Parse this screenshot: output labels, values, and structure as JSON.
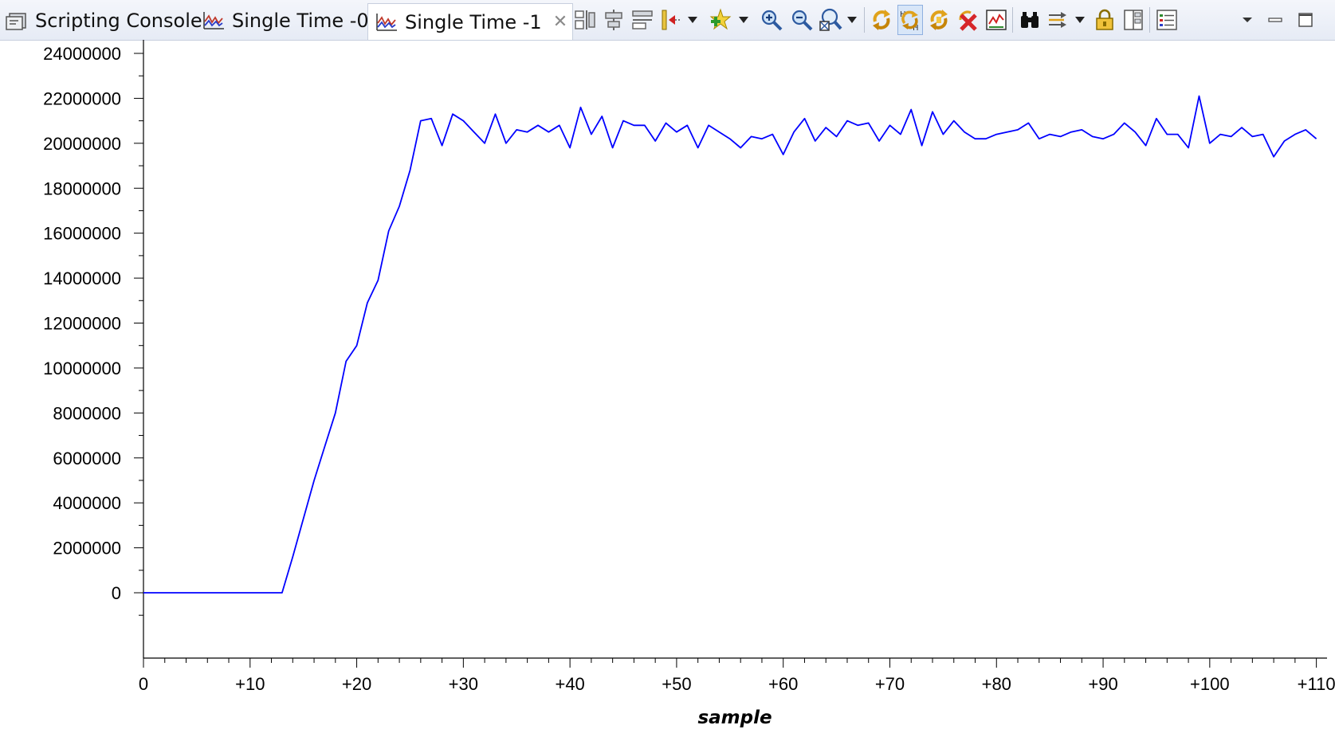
{
  "tabs": [
    {
      "label": "Scripting Console",
      "icon": "scripting-console-icon",
      "active": false
    },
    {
      "label": "Single Time -0",
      "icon": "graph-icon",
      "active": false
    },
    {
      "label": "Single Time -1",
      "icon": "graph-icon",
      "active": true,
      "closable": true
    }
  ],
  "toolbar": [
    "align-columns-icon",
    "align-center-icon",
    "align-rows-icon",
    "set-marker-icon",
    "dropdown-arrow-icon",
    "add-measurement-icon",
    "dropdown-arrow-icon",
    "zoom-in-icon",
    "zoom-out-icon",
    "zoom-fit-icon",
    "dropdown-arrow-icon",
    "refresh-icon",
    "toggle-hex-icon",
    "continuous-refresh-icon",
    "remove-icon",
    "graph-properties-icon",
    "find-icon",
    "import-export-icon",
    "dropdown-arrow-icon",
    "lock-icon",
    "layout-icon",
    "legend-icon"
  ],
  "window_controls": [
    "view-menu-icon",
    "minimize-icon",
    "maximize-icon"
  ],
  "chart_data": {
    "type": "line",
    "title": "",
    "xlabel": "sample",
    "ylabel": "",
    "xlim": [
      0,
      111
    ],
    "ylim": [
      -2000000,
      24000000
    ],
    "grid": false,
    "line_color": "#0000ff",
    "y_ticks": [
      0,
      2000000,
      4000000,
      6000000,
      8000000,
      10000000,
      12000000,
      14000000,
      16000000,
      18000000,
      20000000,
      22000000,
      24000000
    ],
    "y_tick_labels": [
      "0",
      "2000000",
      "4000000",
      "6000000",
      "8000000",
      "10000000",
      "12000000",
      "14000000",
      "16000000",
      "18000000",
      "20000000",
      "22000000",
      "24000000"
    ],
    "x_ticks": [
      0,
      10,
      20,
      30,
      40,
      50,
      60,
      70,
      80,
      90,
      100,
      110
    ],
    "x_tick_labels": [
      "0",
      "+10",
      "+20",
      "+30",
      "+40",
      "+50",
      "+60",
      "+70",
      "+80",
      "+90",
      "+100",
      "+110"
    ],
    "series": [
      {
        "values": [
          0,
          0,
          0,
          0,
          0,
          0,
          0,
          0,
          0,
          0,
          0,
          0,
          0,
          0,
          1600000,
          3300000,
          5000000,
          6500000,
          8000000,
          10300000,
          11000000,
          12900000,
          13900000,
          16100000,
          17200000,
          18800000,
          21000000,
          21100000,
          19900000,
          21300000,
          21000000,
          20500000,
          20000000,
          21300000,
          20000000,
          20600000,
          20500000,
          20800000,
          20500000,
          20800000,
          19800000,
          21600000,
          20400000,
          21200000,
          19800000,
          21000000,
          20800000,
          20800000,
          20100000,
          20900000,
          20500000,
          20800000,
          19800000,
          20800000,
          20500000,
          20200000,
          19800000,
          20300000,
          20200000,
          20400000,
          19500000,
          20500000,
          21100000,
          20100000,
          20700000,
          20300000,
          21000000,
          20800000,
          20900000,
          20100000,
          20800000,
          20400000,
          21500000,
          19900000,
          21400000,
          20400000,
          21000000,
          20500000,
          20200000,
          20200000,
          20400000,
          20500000,
          20600000,
          20900000,
          20200000,
          20400000,
          20300000,
          20500000,
          20600000,
          20300000,
          20200000,
          20400000,
          20900000,
          20500000,
          19900000,
          21100000,
          20400000,
          20400000,
          19800000,
          22100000,
          20000000,
          20400000,
          20300000,
          20700000,
          20300000,
          20400000,
          19400000,
          20100000,
          20400000,
          20600000,
          20200000
        ]
      }
    ]
  }
}
